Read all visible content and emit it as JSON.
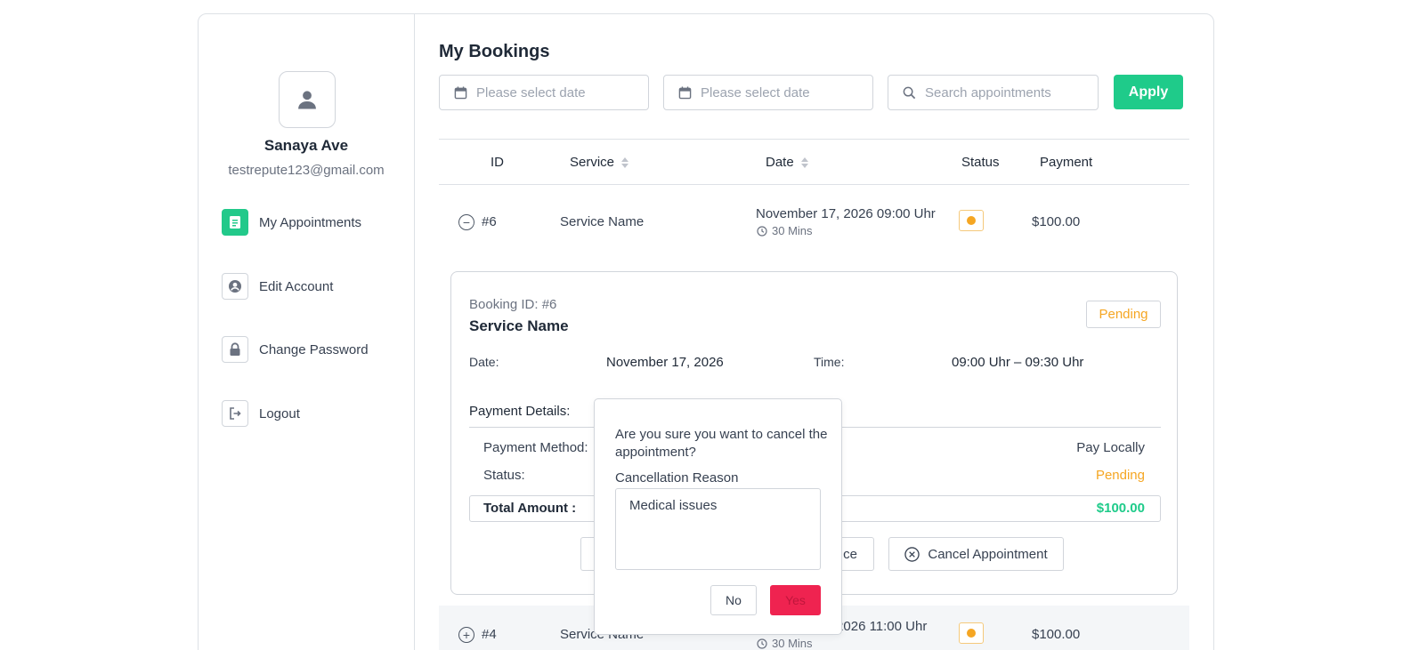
{
  "user": {
    "name": "Sanaya Ave",
    "email": "testrepute123@gmail.com"
  },
  "sidebar": {
    "items": [
      {
        "label": "My Appointments",
        "icon": "document-icon",
        "active": true
      },
      {
        "label": "Edit Account",
        "icon": "user-circle-icon",
        "active": false
      },
      {
        "label": "Change Password",
        "icon": "lock-icon",
        "active": false
      },
      {
        "label": "Logout",
        "icon": "logout-icon",
        "active": false
      }
    ]
  },
  "main": {
    "title": "My Bookings",
    "filters": {
      "start_date_placeholder": "Please select date",
      "end_date_placeholder": "Please select date",
      "search_placeholder": "Search appointments",
      "apply_label": "Apply"
    },
    "table": {
      "headers": [
        "ID",
        "Service",
        "Date",
        "Status",
        "Payment"
      ],
      "rows": [
        {
          "id": "#6",
          "service": "Service Name",
          "date": "November 17, 2026 09:00 Uhr",
          "duration": "30 Mins",
          "status_color": "#f5a623",
          "payment": "$100.00",
          "expanded": true
        },
        {
          "id": "#4",
          "service": "Service Name",
          "date": "November 9, 2026 11:00 Uhr",
          "duration": "30 Mins",
          "status_color": "#f5a623",
          "payment": "$100.00",
          "expanded": false
        }
      ]
    },
    "details": {
      "booking_id": "Booking ID: #6",
      "service": "Service Name",
      "status_badge": "Pending",
      "date_label": "Date:",
      "date_value": "November 17, 2026",
      "time_label": "Time:",
      "time_value": "09:00 Uhr – 09:30 Uhr",
      "payment_title": "Payment Details:",
      "payment_method_label": "Payment Method:",
      "payment_method_value": "Pay Locally",
      "status_label": "Status:",
      "status_value": "Pending",
      "total_label": "Total Amount :",
      "total_value": "$100.00",
      "invoice_fragment": "ce",
      "cancel_label": "Cancel Appointment"
    },
    "popover": {
      "question": "Are you sure you want to cancel the appointment?",
      "reason_label": "Cancellation Reason",
      "reason_value": "Medical issues",
      "no_label": "No",
      "yes_label": "Yes"
    }
  },
  "colors": {
    "accent": "#1fcb8a",
    "pending": "#f5a623",
    "danger": "#ef2350",
    "money": "#1fcb8a"
  }
}
